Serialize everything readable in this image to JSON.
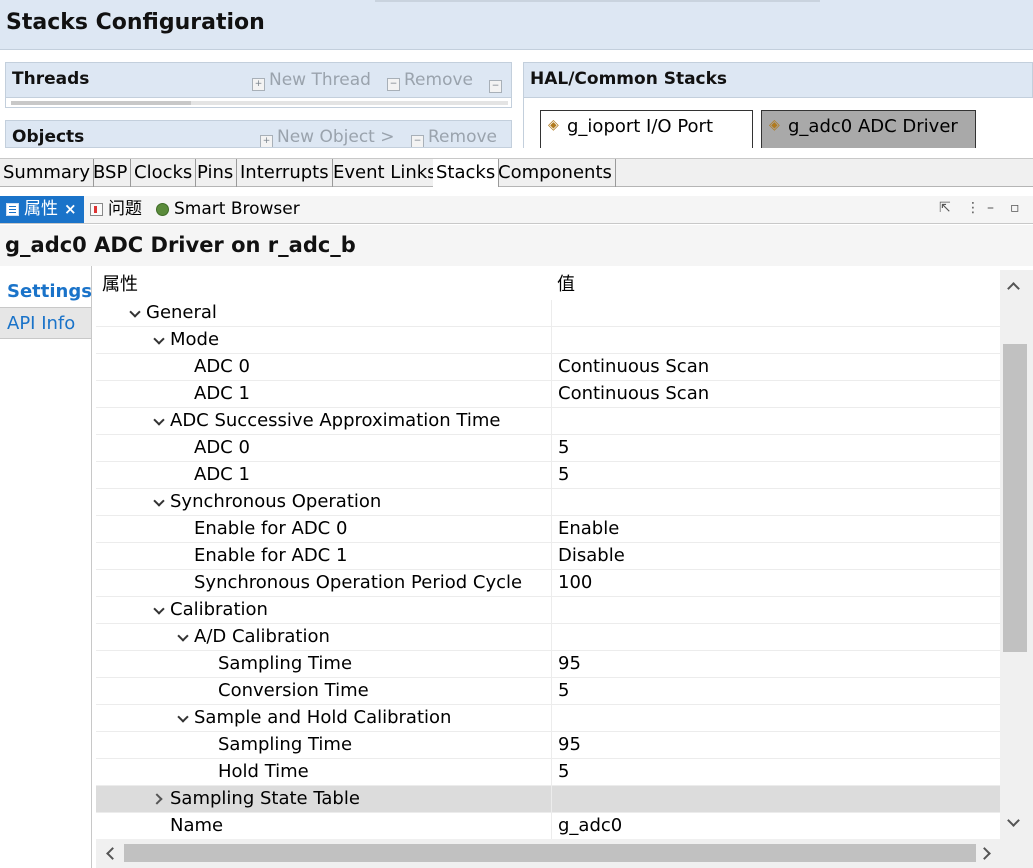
{
  "title": "Stacks Configuration",
  "threads_panel": {
    "title": "Threads",
    "new_label": "New Thread",
    "remove_label": "Remove"
  },
  "objects_panel": {
    "title": "Objects",
    "new_label": "New Object >",
    "remove_label": "Remove"
  },
  "hal_panel": {
    "title": "HAL/Common Stacks",
    "stacks": [
      {
        "label": "g_ioport I/O Port"
      },
      {
        "label": "g_adc0 ADC Driver"
      }
    ]
  },
  "config_tabs": [
    "Summary",
    "BSP",
    "Clocks",
    "Pins",
    "Interrupts",
    "Event Links",
    "Stacks",
    "Components"
  ],
  "active_config_tab": "Stacks",
  "view_tabs": {
    "properties": "属性",
    "problems": "问题",
    "smart_browser": "Smart Browser",
    "close_glyph": "×"
  },
  "heading": "g_adc0 ADC Driver on r_adc_b",
  "side_tabs": {
    "settings": "Settings",
    "api_info": "API Info"
  },
  "table": {
    "col_property": "属性",
    "col_value": "值",
    "rows": [
      {
        "name": "General",
        "value": "",
        "level": 1,
        "expander": "down"
      },
      {
        "name": "Mode",
        "value": "",
        "level": 2,
        "expander": "down"
      },
      {
        "name": "ADC 0",
        "value": "Continuous Scan",
        "level": 3
      },
      {
        "name": "ADC 1",
        "value": "Continuous Scan",
        "level": 3
      },
      {
        "name": "ADC Successive Approximation Time",
        "value": "",
        "level": 2,
        "expander": "down"
      },
      {
        "name": "ADC 0",
        "value": "5",
        "level": 3
      },
      {
        "name": "ADC 1",
        "value": "5",
        "level": 3
      },
      {
        "name": "Synchronous Operation",
        "value": "",
        "level": 2,
        "expander": "down"
      },
      {
        "name": "Enable for ADC 0",
        "value": "Enable",
        "level": 3
      },
      {
        "name": "Enable for ADC 1",
        "value": "Disable",
        "level": 3
      },
      {
        "name": "Synchronous Operation Period Cycle",
        "value": "100",
        "level": 3
      },
      {
        "name": "Calibration",
        "value": "",
        "level": 2,
        "expander": "down"
      },
      {
        "name": "A/D Calibration",
        "value": "",
        "level": 3,
        "expander": "down"
      },
      {
        "name": "Sampling Time",
        "value": "95",
        "level": 4
      },
      {
        "name": "Conversion Time",
        "value": "5",
        "level": 4
      },
      {
        "name": "Sample and Hold Calibration",
        "value": "",
        "level": 3,
        "expander": "down"
      },
      {
        "name": "Sampling Time",
        "value": "95",
        "level": 4
      },
      {
        "name": "Hold Time",
        "value": "5",
        "level": 4
      },
      {
        "name": "Sampling State Table",
        "value": "",
        "level": 2,
        "expander": "right",
        "selected": true
      },
      {
        "name": "Name",
        "value": "g_adc0",
        "level": 2
      }
    ]
  }
}
